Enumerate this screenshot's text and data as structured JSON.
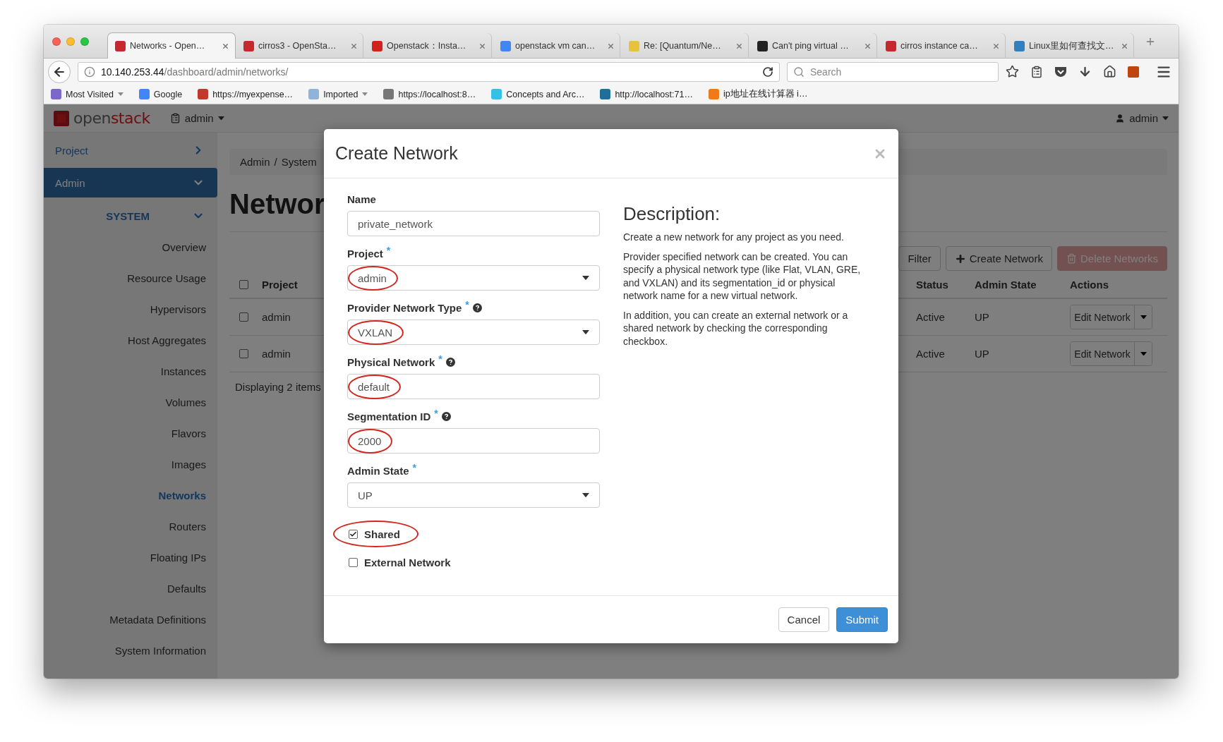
{
  "browser": {
    "tabs": [
      {
        "title": "Networks - Open…",
        "selected": true,
        "color": "#c8282d"
      },
      {
        "title": "cirros3 - OpenSta…",
        "selected": false,
        "color": "#c8282d"
      },
      {
        "title": "Openstack：Insta…",
        "selected": false,
        "color": "#d0231c"
      },
      {
        "title": "openstack vm can…",
        "selected": false,
        "color": "#4285f4"
      },
      {
        "title": "Re: [Quantum/Ne…",
        "selected": false,
        "color": "#e8c33a"
      },
      {
        "title": "Can't ping virtual …",
        "selected": false,
        "color": "#222222"
      },
      {
        "title": "cirros instance ca…",
        "selected": false,
        "color": "#c8282d"
      },
      {
        "title": "Linux里如何查找文…",
        "selected": false,
        "color": "#2f7fc1"
      }
    ],
    "url": {
      "host": "10.140.253.44",
      "path": "/dashboard/admin/networks/"
    },
    "search": {
      "placeholder": "Search"
    },
    "bookmarks": [
      {
        "label": "Most Visited",
        "dropdown": true,
        "color": "#7b68c8"
      },
      {
        "label": "Google",
        "dropdown": false,
        "color": "#4285f4"
      },
      {
        "label": "https://myexpense…",
        "dropdown": false,
        "color": "#c0392b"
      },
      {
        "label": "Imported",
        "dropdown": true,
        "color": "#8fb3d9"
      },
      {
        "label": "https://localhost:8…",
        "dropdown": false,
        "color": "#777777"
      },
      {
        "label": "Concepts and Arc…",
        "dropdown": false,
        "color": "#35c0e8"
      },
      {
        "label": "http://localhost:71…",
        "dropdown": false,
        "color": "#1f6f9a"
      },
      {
        "label": "ip地址在线计算器 i…",
        "dropdown": false,
        "color": "#f07a1a"
      }
    ]
  },
  "app": {
    "logo": [
      "open",
      "stack"
    ],
    "project_menu": "admin",
    "user_menu": "admin"
  },
  "sidebar": {
    "panels": [
      {
        "label": "Project",
        "selected": false,
        "expanded": false
      },
      {
        "label": "Admin",
        "selected": true,
        "expanded": true
      }
    ],
    "group": {
      "label": "SYSTEM",
      "expanded": true
    },
    "items": [
      {
        "label": "Overview",
        "selected": false
      },
      {
        "label": "Resource Usage",
        "selected": false
      },
      {
        "label": "Hypervisors",
        "selected": false
      },
      {
        "label": "Host Aggregates",
        "selected": false
      },
      {
        "label": "Instances",
        "selected": false
      },
      {
        "label": "Volumes",
        "selected": false
      },
      {
        "label": "Flavors",
        "selected": false
      },
      {
        "label": "Images",
        "selected": false
      },
      {
        "label": "Networks",
        "selected": true
      },
      {
        "label": "Routers",
        "selected": false
      },
      {
        "label": "Floating IPs",
        "selected": false
      },
      {
        "label": "Defaults",
        "selected": false
      },
      {
        "label": "Metadata Definitions",
        "selected": false
      },
      {
        "label": "System Information",
        "selected": false
      }
    ]
  },
  "page": {
    "breadcrumb": [
      "Admin",
      "System"
    ],
    "separator": "/",
    "heading": "Networ",
    "actions": {
      "filter": "Filter",
      "create": "Create Network",
      "delete": "Delete Networks"
    },
    "table": {
      "columns": [
        "Project",
        "Status",
        "Admin State",
        "Actions"
      ],
      "header_checked": false,
      "rows": [
        {
          "checked": false,
          "project": "admin",
          "status": "Active",
          "admin_state": "UP",
          "action": "Edit Network"
        },
        {
          "checked": false,
          "project": "admin",
          "status": "Active",
          "admin_state": "UP",
          "action": "Edit Network"
        }
      ]
    },
    "footer": "Displaying 2 items"
  },
  "modal": {
    "title": "Create Network",
    "fields": [
      {
        "kind": "text",
        "label": "Name",
        "required": false,
        "help": false,
        "value": "private_network",
        "highlighted": false
      },
      {
        "kind": "select",
        "label": "Project",
        "required": true,
        "help": false,
        "value": "admin",
        "highlighted": true
      },
      {
        "kind": "select",
        "label": "Provider Network Type",
        "required": true,
        "help": true,
        "value": "VXLAN",
        "highlighted": true
      },
      {
        "kind": "text",
        "label": "Physical Network",
        "required": true,
        "help": true,
        "value": "default",
        "highlighted": true
      },
      {
        "kind": "text",
        "label": "Segmentation ID",
        "required": true,
        "help": true,
        "value": "2000",
        "highlighted": true
      },
      {
        "kind": "select",
        "label": "Admin State",
        "required": true,
        "help": false,
        "value": "UP",
        "highlighted": false
      },
      {
        "kind": "checkbox",
        "label": "Shared",
        "checked": true,
        "highlighted": true
      },
      {
        "kind": "checkbox",
        "label": "External Network",
        "checked": false,
        "highlighted": false
      }
    ],
    "required_mark": "*",
    "description": {
      "title": "Description:",
      "paragraphs": [
        "Create a new network for any project as you need.",
        "Provider specified network can be created. You can specify a physical network type (like Flat, VLAN, GRE, and VXLAN) and its segmentation_id or physical network name for a new virtual network.",
        "In addition, you can create an external network or a shared network by checking the corresponding checkbox."
      ]
    },
    "buttons": {
      "cancel": "Cancel",
      "submit": "Submit"
    }
  }
}
